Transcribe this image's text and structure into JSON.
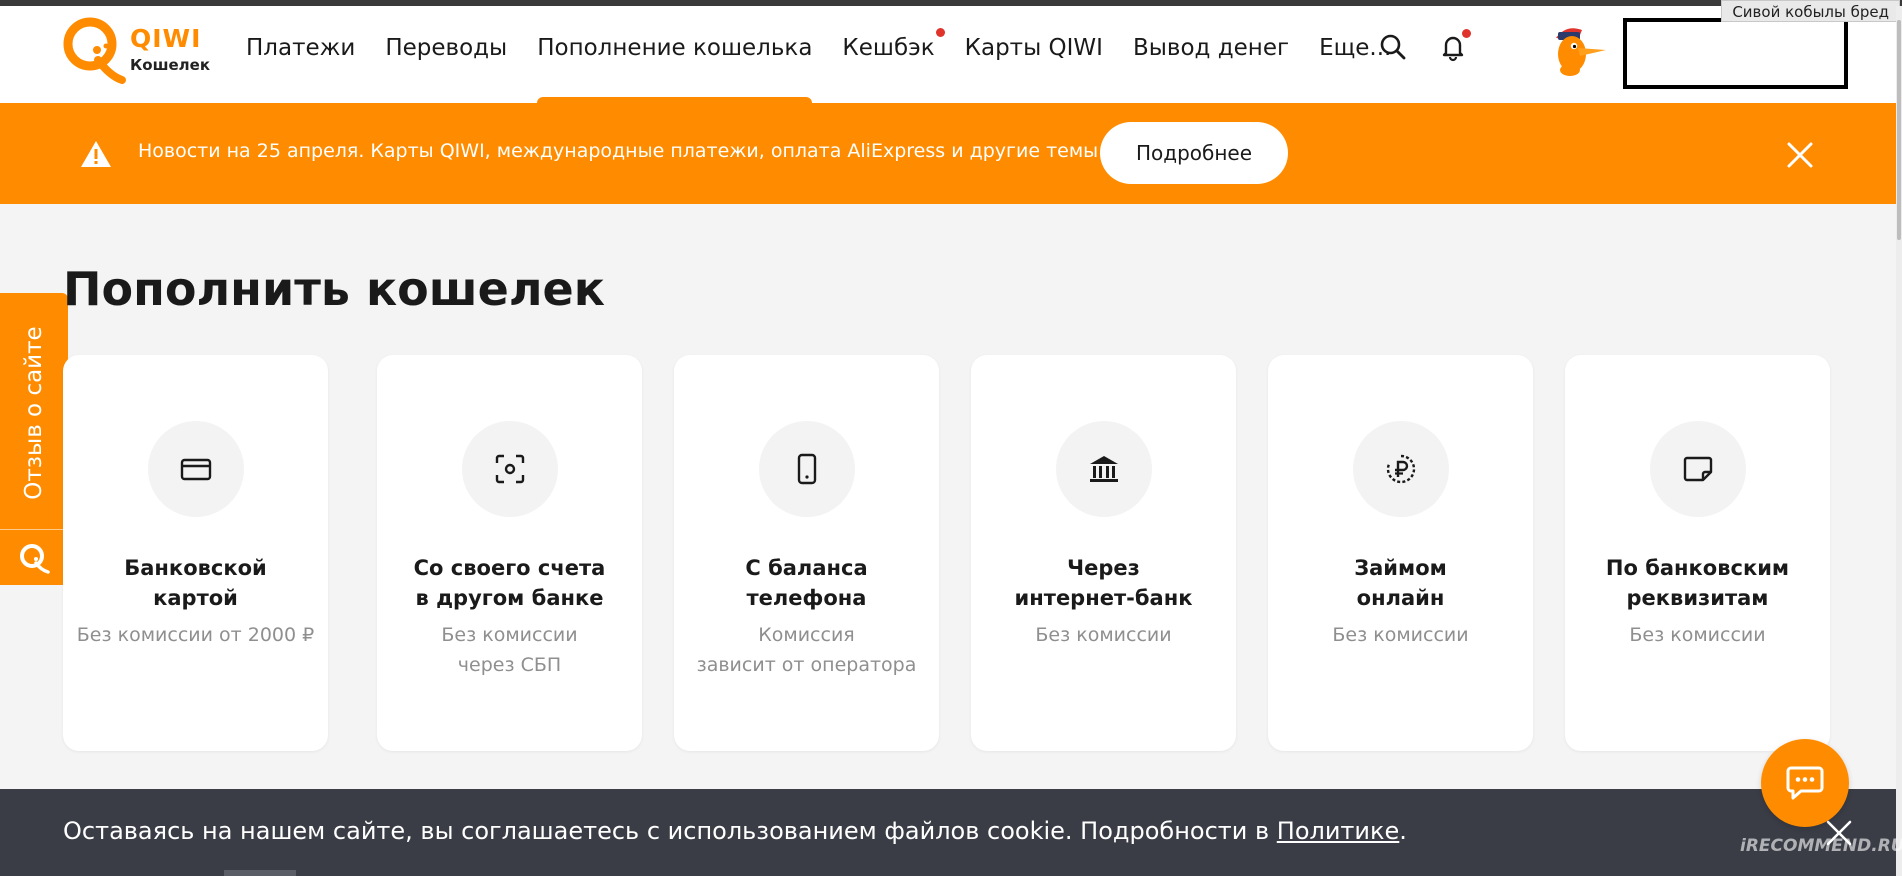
{
  "browser": {
    "caption": "Сивой кобылы бред"
  },
  "logo": {
    "brand": "QIWI",
    "product": "Кошелек"
  },
  "nav": {
    "items": [
      {
        "label": "Платежи",
        "active": false,
        "dot": false
      },
      {
        "label": "Переводы",
        "active": false,
        "dot": false
      },
      {
        "label": "Пополнение кошелька",
        "active": true,
        "dot": false
      },
      {
        "label": "Кешбэк",
        "active": false,
        "dot": true
      },
      {
        "label": "Карты QIWI",
        "active": false,
        "dot": false
      },
      {
        "label": "Вывод денег",
        "active": false,
        "dot": false
      },
      {
        "label": "Еще...",
        "active": false,
        "dot": false
      }
    ]
  },
  "banner": {
    "text": "Новости на 25 апреля. Карты QIWI, международные платежи, оплата AliExpress и другие темы",
    "button": "Подробнее"
  },
  "feedback": {
    "label": "Отзыв о сайте"
  },
  "page": {
    "title": "Пополнить кошелек"
  },
  "cards": [
    {
      "icon": "bank-card-icon",
      "title_1": "Банковской",
      "title_2": "картой",
      "sub_1": "Без комиссии от 2000 ₽",
      "sub_2": ""
    },
    {
      "icon": "sbp-icon",
      "title_1": "Со своего счета",
      "title_2": "в другом банке",
      "sub_1": "Без комиссии",
      "sub_2": "через СБП"
    },
    {
      "icon": "phone-icon",
      "title_1": "С баланса",
      "title_2": "телефона",
      "sub_1": "Комиссия",
      "sub_2": "зависит от оператора"
    },
    {
      "icon": "bank-building-icon",
      "title_1": "Через",
      "title_2": "интернет-банк",
      "sub_1": "Без комиссии",
      "sub_2": ""
    },
    {
      "icon": "loan-ruble-icon",
      "title_1": "Займом",
      "title_2": "онлайн",
      "sub_1": "Без комиссии",
      "sub_2": ""
    },
    {
      "icon": "requisites-icon",
      "title_1": "По банковским",
      "title_2": "реквизитам",
      "sub_1": "Без комиссии",
      "sub_2": ""
    }
  ],
  "cookie": {
    "text": "Оставаясь на нашем сайте, вы соглашаетесь с использованием файлов cookie. Подробности в ",
    "link": "Политике",
    "tail": "."
  },
  "watermark": "iRECOMMEND.RU",
  "colors": {
    "accent": "#ff8c00",
    "notification": "#e0332c",
    "cookie_bg": "#3a3d46"
  }
}
